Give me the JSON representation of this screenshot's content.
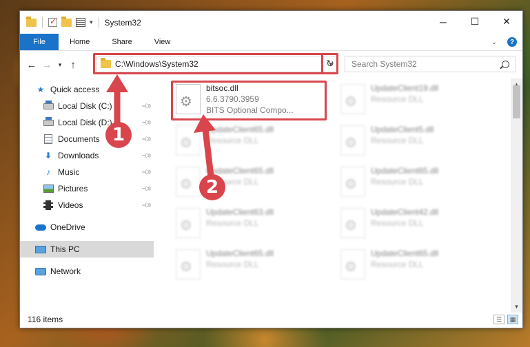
{
  "window": {
    "title": "System32",
    "controls": {
      "minimize": "─",
      "maximize": "☐",
      "close": "✕"
    }
  },
  "ribbon": {
    "tabs": [
      "File",
      "Home",
      "Share",
      "View"
    ]
  },
  "address_bar": {
    "path": "C:\\Windows\\System32",
    "search_placeholder": "Search System32"
  },
  "sidebar": {
    "quick_access": "Quick access",
    "items": [
      {
        "label": "Local Disk (C:)"
      },
      {
        "label": "Local Disk (D:)"
      },
      {
        "label": "Documents"
      },
      {
        "label": "Downloads"
      },
      {
        "label": "Music"
      },
      {
        "label": "Pictures"
      },
      {
        "label": "Videos"
      }
    ],
    "onedrive": "OneDrive",
    "this_pc": "This PC",
    "network": "Network"
  },
  "files": {
    "selected": {
      "name": "bitsoc.dll",
      "version": "6.6.3790.3959",
      "description": "BITS Optional Compo..."
    },
    "others": [
      {
        "name": "UpdateClient19.dll",
        "type": "Resource DLL"
      },
      {
        "name": "UpdateClient65.dll",
        "type": "Resource DLL"
      },
      {
        "name": "UpdateClient5.dll",
        "type": "Resource DLL"
      },
      {
        "name": "UpdateClient65.dll",
        "type": "Resource DLL"
      },
      {
        "name": "UpdateClient65.dll",
        "type": "Resource DLL"
      },
      {
        "name": "UpdateClient63.dll",
        "type": "Resource DLL"
      },
      {
        "name": "UpdateClient42.dll",
        "type": "Resource DLL"
      },
      {
        "name": "UpdateClient65.dll",
        "type": "Resource DLL"
      },
      {
        "name": "UpdateClient65.dll",
        "type": "Resource DLL"
      }
    ]
  },
  "status": {
    "item_count": "116 items"
  },
  "annotations": {
    "step1": "1",
    "step2": "2"
  },
  "colors": {
    "accent": "#1a73c8",
    "annotation": "#d9454c"
  }
}
